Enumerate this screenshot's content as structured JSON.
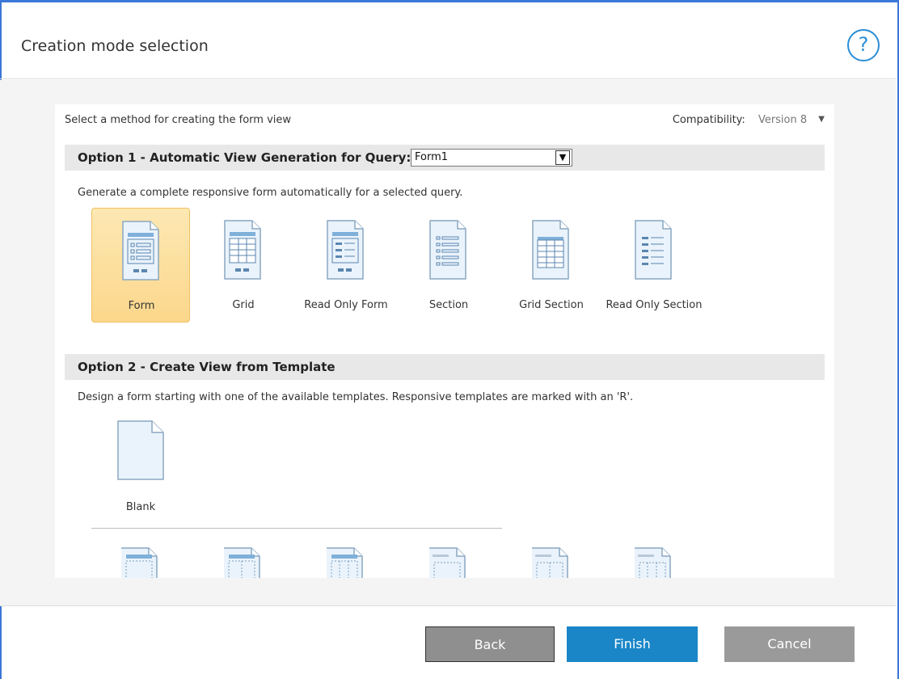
{
  "dialog": {
    "title": "Creation mode selection",
    "help_icon": "?"
  },
  "top": {
    "instruction": "Select a method for creating the form view",
    "compat_label": "Compatibility:",
    "compat_value": "Version 8"
  },
  "option1": {
    "title": "Option 1 - Automatic View Generation for Query:",
    "query_value": "Form1",
    "description": "Generate a complete responsive form automatically for a selected query.",
    "tiles": [
      {
        "label": "Form",
        "icon": "form-icon",
        "selected": true
      },
      {
        "label": "Grid",
        "icon": "grid-icon",
        "selected": false
      },
      {
        "label": "Read Only Form",
        "icon": "read-only-form-icon",
        "selected": false
      },
      {
        "label": "Section",
        "icon": "section-icon",
        "selected": false
      },
      {
        "label": "Grid Section",
        "icon": "grid-section-icon",
        "selected": false
      },
      {
        "label": "Read Only Section",
        "icon": "read-only-section-icon",
        "selected": false
      }
    ]
  },
  "option2": {
    "title": "Option 2 - Create View from Template",
    "description": "Design a form starting with one of the available templates. Responsive templates are marked with an 'R'.",
    "blank_label": "Blank"
  },
  "footer": {
    "back_label": "Back",
    "finish_label": "Finish",
    "cancel_label": "Cancel"
  },
  "colors": {
    "accent": "#1a86c8",
    "selected_tile": "#fbd78b",
    "frame_border": "#3b78d8"
  }
}
